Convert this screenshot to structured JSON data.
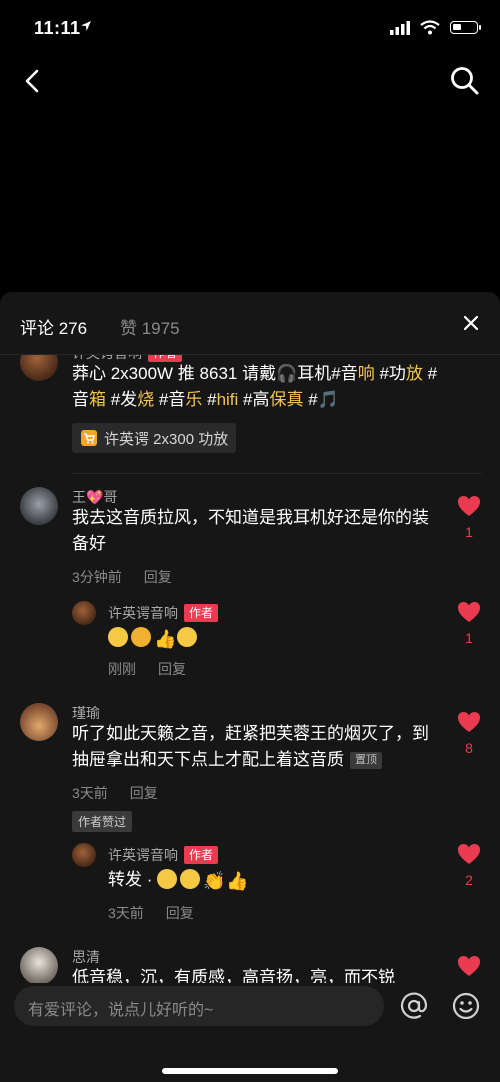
{
  "status": {
    "time": "11:11",
    "battery_level": 0.35
  },
  "tabs": {
    "comments": "评论 276",
    "likes": "赞 1975"
  },
  "comments": [
    {
      "user": "许英谔音响",
      "tag": "作者",
      "text_parts": [
        {
          "t": "莽心 2x300W 推 8631 请戴"
        },
        {
          "t": "耳机#音",
          "hl": false
        },
        {
          "t": "响",
          "hl": true
        },
        {
          "t": " #功"
        },
        {
          "t": "放",
          "hl": true
        },
        {
          "t": " #音"
        },
        {
          "t": "箱",
          "hl": true
        },
        {
          "t": " #发"
        },
        {
          "t": "烧",
          "hl": true
        },
        {
          "t": " #音"
        },
        {
          "t": "乐",
          "hl": true
        },
        {
          "t": " #"
        },
        {
          "t": "hifi",
          "hl": true
        },
        {
          "t": " #高"
        },
        {
          "t": "保真",
          "hl": true
        },
        {
          "t": " #"
        }
      ],
      "product": "许英谔 2x300 功放"
    },
    {
      "user": "王💖哥",
      "text": "我去这音质拉风，不知道是我耳机好还是你的装备好",
      "time": "3分钟前",
      "reply": "回复",
      "likes": "1"
    },
    {
      "user": "许英谔音响",
      "tag": "作者",
      "time": "刚刚",
      "reply": "回复",
      "likes": "1"
    },
    {
      "user": "瑾瑜",
      "text": "听了如此天籁之音，赶紧把芙蓉王的烟灭了，到抽屉拿出和天下点上才配上着这音质",
      "pinned": "置顶",
      "time": "3天前",
      "reply": "回复",
      "author_liked": "作者赞过",
      "likes": "8"
    },
    {
      "user": "许英谔音响",
      "tag": "作者",
      "text": "转发 ·",
      "time": "3天前",
      "reply": "回复",
      "likes": "2"
    },
    {
      "user": "思清",
      "text": "低音稳，沉，有质感，高音扬，亮，而不锐"
    }
  ],
  "input": {
    "placeholder": "有爱评论，说点儿好听的~"
  },
  "colors": {
    "accent": "#ea3b51",
    "highlight": "#f5c452"
  }
}
